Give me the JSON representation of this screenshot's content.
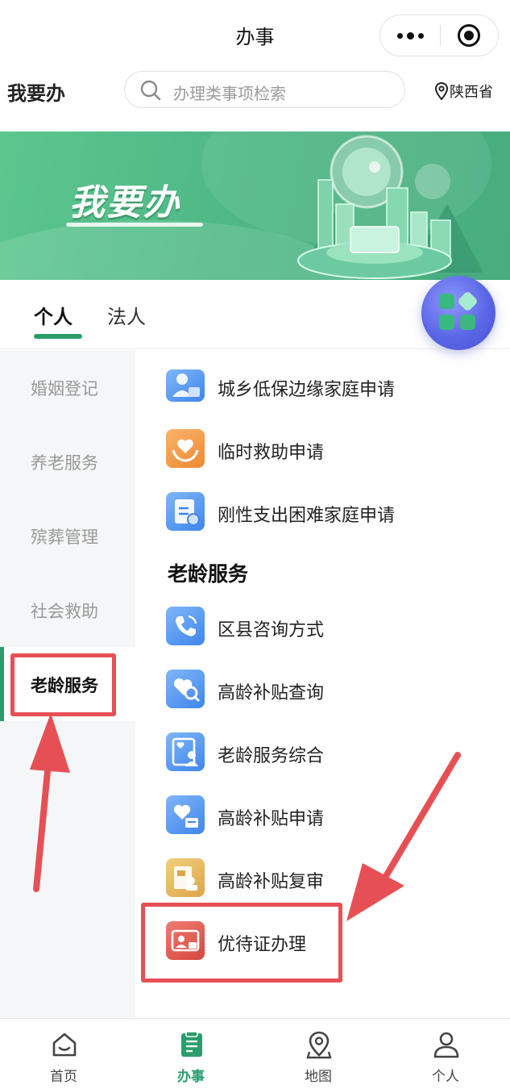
{
  "titlebar": {
    "title": "办事"
  },
  "header": {
    "page_title": "我要办",
    "search_placeholder": "办理类事项检索",
    "location": "陕西省"
  },
  "banner": {
    "title": "我要办"
  },
  "tabs": [
    {
      "label": "个人",
      "active": true
    },
    {
      "label": "法人",
      "active": false
    }
  ],
  "sidebar": {
    "items": [
      {
        "label": "婚姻登记"
      },
      {
        "label": "养老服务"
      },
      {
        "label": "殡葬管理"
      },
      {
        "label": "社会救助"
      },
      {
        "label": "老龄服务",
        "active": true
      }
    ]
  },
  "content": {
    "prev_items": [
      {
        "label": "城乡低保边缘家庭申请",
        "icon": "edge-family-icon",
        "color": "#3f86ec"
      },
      {
        "label": "临时救助申请",
        "icon": "heart-hands-icon",
        "color": "#ee8a34"
      },
      {
        "label": "刚性支出困难家庭申请",
        "icon": "expense-document-icon",
        "color": "#3f86ec"
      }
    ],
    "section_title": "老龄服务",
    "items": [
      {
        "label": "区县咨询方式",
        "icon": "phone-icon",
        "color": "#3f86ec"
      },
      {
        "label": "高龄补贴查询",
        "icon": "heart-search-icon",
        "color": "#3f86ec"
      },
      {
        "label": "老龄服务综合",
        "icon": "elder-service-icon",
        "color": "#3f86ec"
      },
      {
        "label": "高龄补贴申请",
        "icon": "subsidy-apply-icon",
        "color": "#3f86ec"
      },
      {
        "label": "高龄补贴复审",
        "icon": "subsidy-review-icon",
        "color": "#dca64a"
      },
      {
        "label": "优待证办理",
        "icon": "preferential-card-icon",
        "color": "#d6463e"
      }
    ]
  },
  "bottom_nav": [
    {
      "label": "首页",
      "icon": "home-icon"
    },
    {
      "label": "办事",
      "icon": "service-icon",
      "active": true
    },
    {
      "label": "地图",
      "icon": "map-icon"
    },
    {
      "label": "个人",
      "icon": "person-icon"
    }
  ],
  "colors": {
    "brand_green": "#2a9d6c",
    "annotation_red": "#e65054",
    "float_button": "#5b66e6"
  }
}
